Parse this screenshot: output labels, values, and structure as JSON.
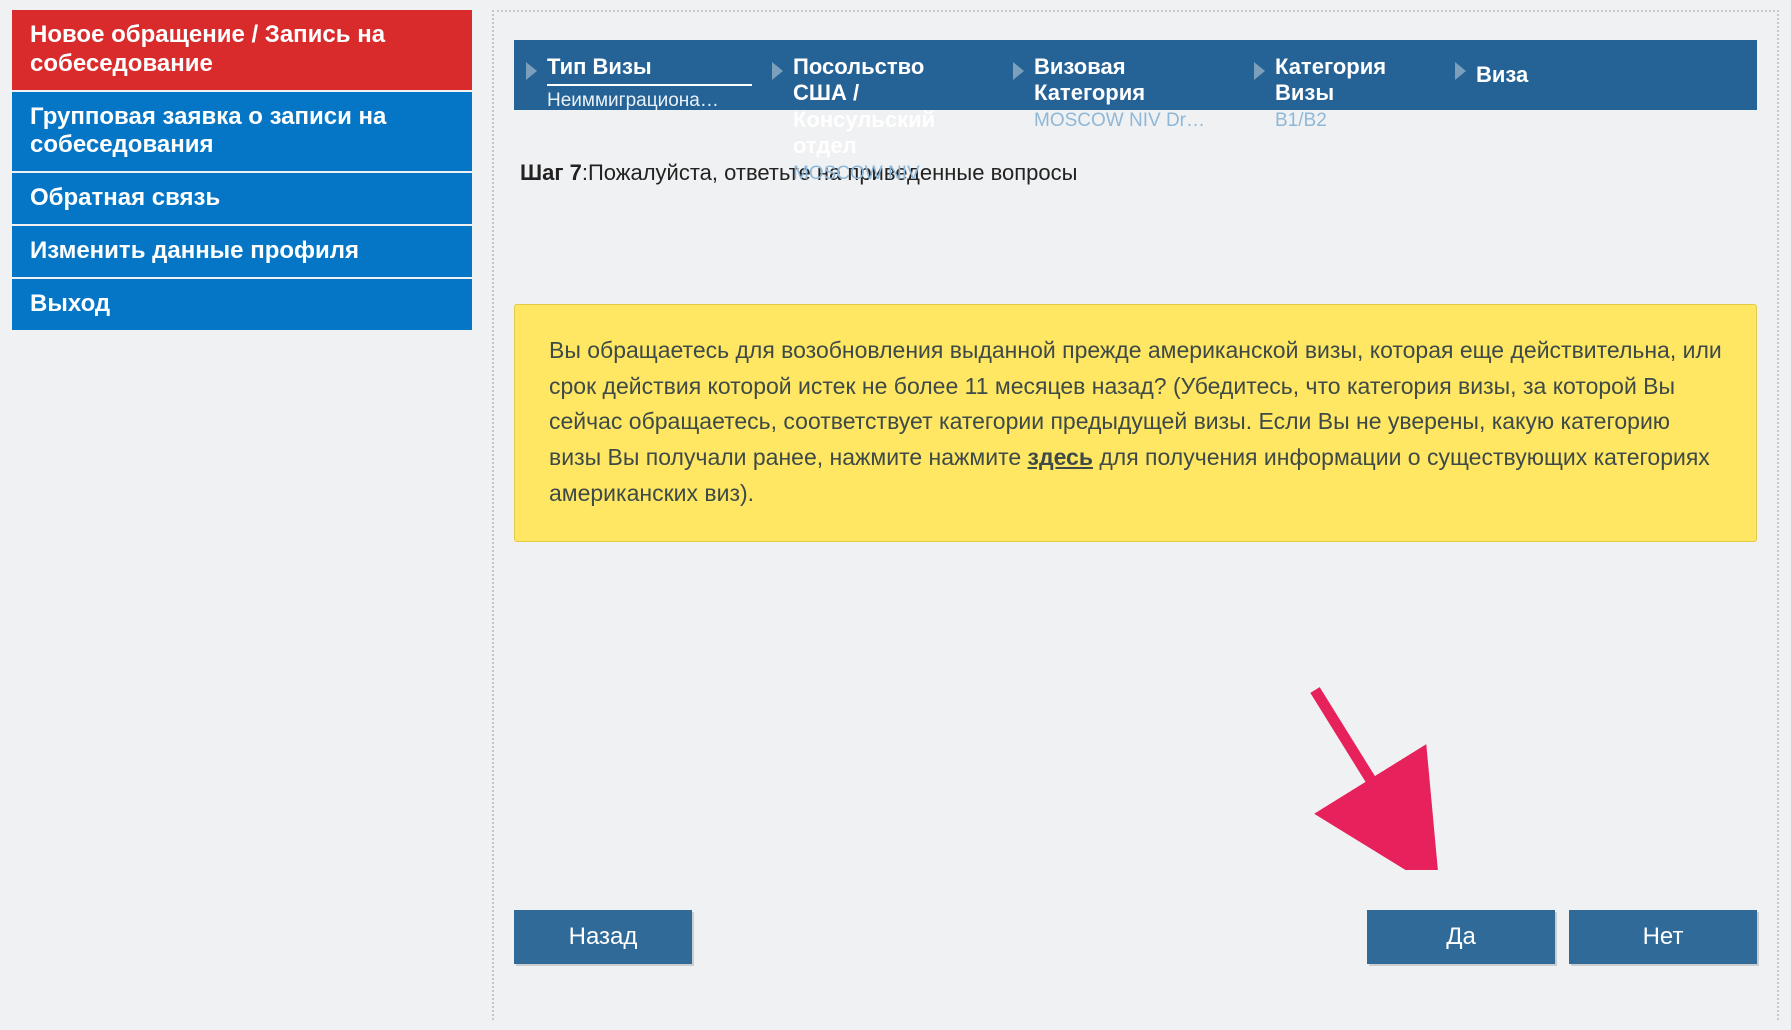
{
  "sidebar": {
    "items": [
      {
        "label": "Новое обращение / Запись на собеседование",
        "active": true
      },
      {
        "label": "Групповая заявка о записи на собеседования",
        "active": false
      },
      {
        "label": "Обратная связь",
        "active": false
      },
      {
        "label": "Изменить данные профиля",
        "active": false
      },
      {
        "label": "Выход",
        "active": false
      }
    ]
  },
  "breadcrumb": {
    "items": [
      {
        "title": "Тип Визы",
        "sub": "Неиммиграциона…"
      },
      {
        "title": "Посольство США / Консульский отдел",
        "sub": "MOSCOW NIV"
      },
      {
        "title": "Визовая Категория",
        "sub": "MOSCOW NIV Dr…"
      },
      {
        "title": "Категория Визы",
        "sub": "B1/B2"
      },
      {
        "title": "Виза",
        "sub": ""
      }
    ]
  },
  "step": {
    "label": "Шаг 7",
    "text": ":Пожалуйста, ответьте на приведенные вопросы"
  },
  "notice": {
    "part1": "Вы обращаетесь для возобновления выданной прежде американской визы, которая еще действительна, или срок действия которой истек не более 11 месяцев назад? (Убедитесь, что категория визы, за которой Вы сейчас обращаетесь, соответствует  категории предыдущей визы. Если Вы не уверены,  какую категорию визы Вы получали  ранее,  нажмите нажмите ",
    "link": "здесь",
    "part2": "  для получения информации о существующих категориях американских виз)."
  },
  "buttons": {
    "back": "Назад",
    "yes": "Да",
    "no": "Нет"
  }
}
